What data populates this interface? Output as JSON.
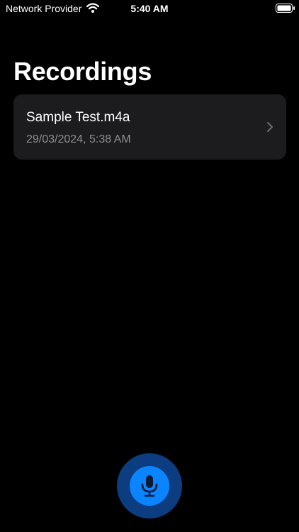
{
  "status_bar": {
    "carrier": "Network Provider",
    "time": "5:40 AM",
    "wifi_icon": "wifi-icon",
    "battery_icon": "battery-full-icon"
  },
  "page": {
    "title": "Recordings"
  },
  "recordings": [
    {
      "name": "Sample Test.m4a",
      "date": "29/03/2024, 5:38 AM",
      "icon": "chevron-right-icon"
    }
  ],
  "record_button": {
    "icon": "microphone-icon",
    "colors": {
      "outer": "#0b3d80",
      "inner": "#0a84ff"
    }
  },
  "colors": {
    "background": "#000000",
    "card": "#1c1c1e",
    "secondary_text": "#8e8e93"
  }
}
